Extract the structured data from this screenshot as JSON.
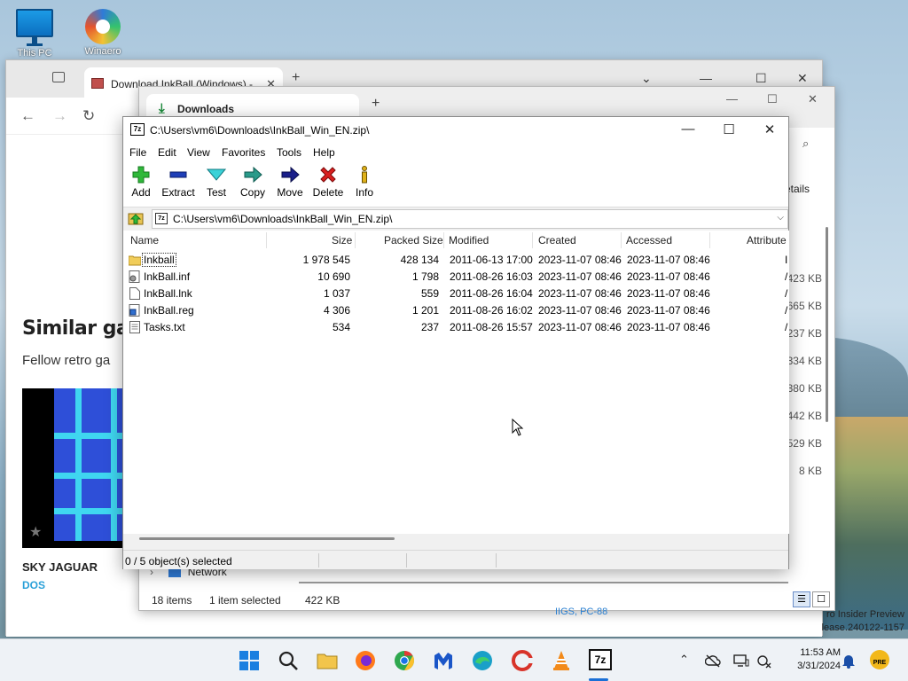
{
  "desktop": {
    "icons": [
      {
        "label": "This PC"
      },
      {
        "label": "Winaero"
      }
    ],
    "watermark_line1": "ro Insider Preview",
    "watermark_line2": "lease.240122-1157"
  },
  "browser": {
    "tab_title": "Download InkBall (Windows) -",
    "heading": "Similar gan",
    "subheading": "Fellow retro ga",
    "game_title": "SKY JAGUAR",
    "game_platform": "DOS",
    "partial_platform": "IIGS, PC-88"
  },
  "explorer": {
    "tab_title": "Downloads",
    "details_label": "etails",
    "sizes": [
      "423 KB",
      "665 KB",
      "237 KB",
      "334 KB",
      "380 KB",
      "442 KB",
      "529 KB",
      "8 KB"
    ],
    "network_label": "Network",
    "status_items": "18 items",
    "status_selected": "1 item selected",
    "status_size": "422 KB"
  },
  "sevenzip": {
    "title": "C:\\Users\\vm6\\Downloads\\InkBall_Win_EN.zip\\",
    "menu": [
      "File",
      "Edit",
      "View",
      "Favorites",
      "Tools",
      "Help"
    ],
    "toolbar": {
      "add": "Add",
      "extract": "Extract",
      "test": "Test",
      "copy": "Copy",
      "move": "Move",
      "delete": "Delete",
      "info": "Info"
    },
    "address": "C:\\Users\\vm6\\Downloads\\InkBall_Win_EN.zip\\",
    "columns": {
      "name": "Name",
      "size": "Size",
      "packed": "Packed Size",
      "modified": "Modified",
      "created": "Created",
      "accessed": "Accessed",
      "attributes": "Attribute"
    },
    "files": [
      {
        "name": "Inkball",
        "size": "1 978 545",
        "packed": "428 134",
        "modified": "2011-06-13 17:00",
        "created": "2023-11-07 08:46",
        "accessed": "2023-11-07 08:46",
        "attr": "I",
        "icon": "folder-icon"
      },
      {
        "name": "InkBall.inf",
        "size": "10 690",
        "packed": "1 798",
        "modified": "2011-08-26 16:03",
        "created": "2023-11-07 08:46",
        "accessed": "2023-11-07 08:46",
        "attr": "/",
        "icon": "inf-file-icon"
      },
      {
        "name": "InkBall.lnk",
        "size": "1 037",
        "packed": "559",
        "modified": "2011-08-26 16:04",
        "created": "2023-11-07 08:46",
        "accessed": "2023-11-07 08:46",
        "attr": "/",
        "icon": "file-icon"
      },
      {
        "name": "InkBall.reg",
        "size": "4 306",
        "packed": "1 201",
        "modified": "2011-08-26 16:02",
        "created": "2023-11-07 08:46",
        "accessed": "2023-11-07 08:46",
        "attr": "/",
        "icon": "reg-file-icon"
      },
      {
        "name": "Tasks.txt",
        "size": "534",
        "packed": "237",
        "modified": "2011-08-26 15:57",
        "created": "2023-11-07 08:46",
        "accessed": "2023-11-07 08:46",
        "attr": "/",
        "icon": "text-file-icon"
      }
    ],
    "status": "0 / 5 object(s) selected"
  },
  "taskbar": {
    "time": "11:53 AM",
    "date": "3/31/2024",
    "badge": "PRE"
  }
}
